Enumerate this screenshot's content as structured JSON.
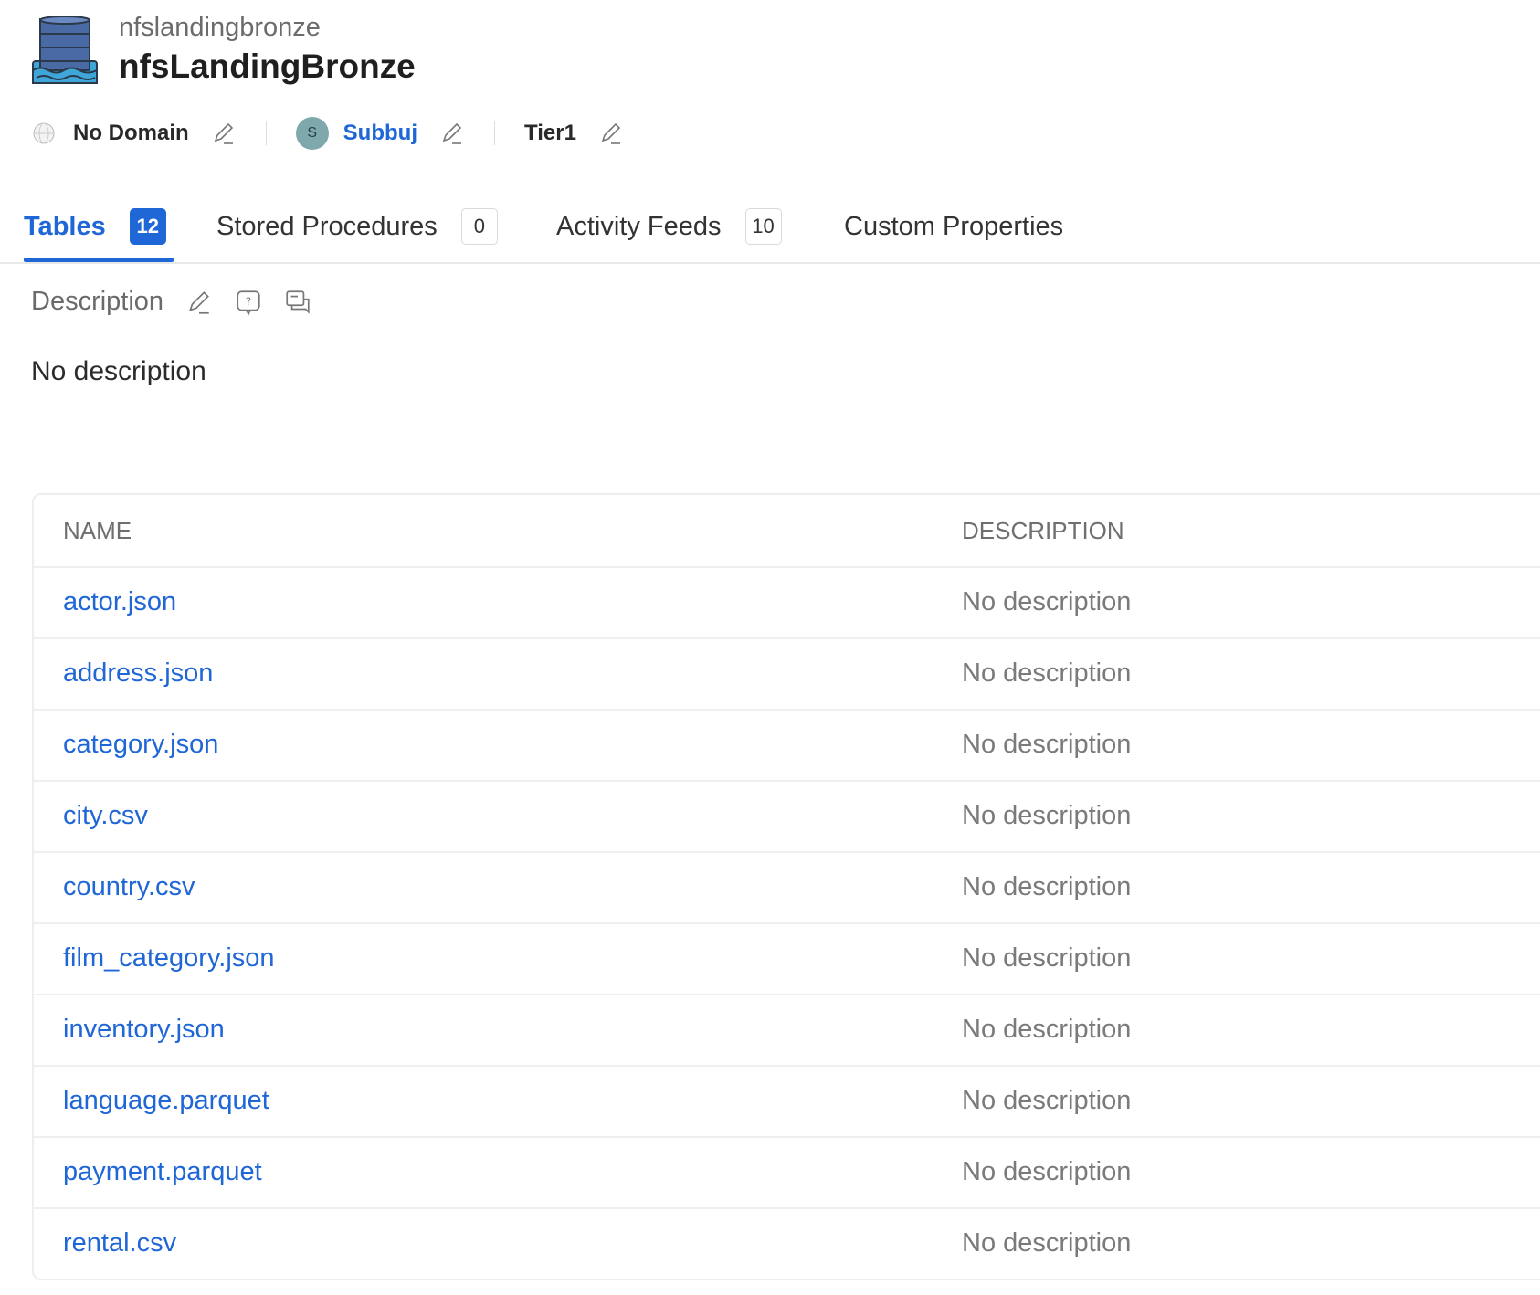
{
  "header": {
    "subtitle": "nfslandingbronze",
    "title": "nfsLandingBronze"
  },
  "meta": {
    "domain": "No Domain",
    "owner_initial": "S",
    "owner": "Subbuj",
    "tier": "Tier1"
  },
  "tabs": [
    {
      "label": "Tables",
      "count": "12"
    },
    {
      "label": "Stored Procedures",
      "count": "0"
    },
    {
      "label": "Activity Feeds",
      "count": "10"
    },
    {
      "label": "Custom Properties"
    }
  ],
  "description": {
    "heading": "Description",
    "text": "No description"
  },
  "table": {
    "headers": [
      "NAME",
      "DESCRIPTION"
    ],
    "rows": [
      {
        "name": "actor.json",
        "description": "No description"
      },
      {
        "name": "address.json",
        "description": "No description"
      },
      {
        "name": "category.json",
        "description": "No description"
      },
      {
        "name": "city.csv",
        "description": "No description"
      },
      {
        "name": "country.csv",
        "description": "No description"
      },
      {
        "name": "film_category.json",
        "description": "No description"
      },
      {
        "name": "inventory.json",
        "description": "No description"
      },
      {
        "name": "language.parquet",
        "description": "No description"
      },
      {
        "name": "payment.parquet",
        "description": "No description"
      },
      {
        "name": "rental.csv",
        "description": "No description"
      }
    ]
  },
  "colors": {
    "accent": "#1f66d6",
    "avatar": "#7fa8ad"
  }
}
